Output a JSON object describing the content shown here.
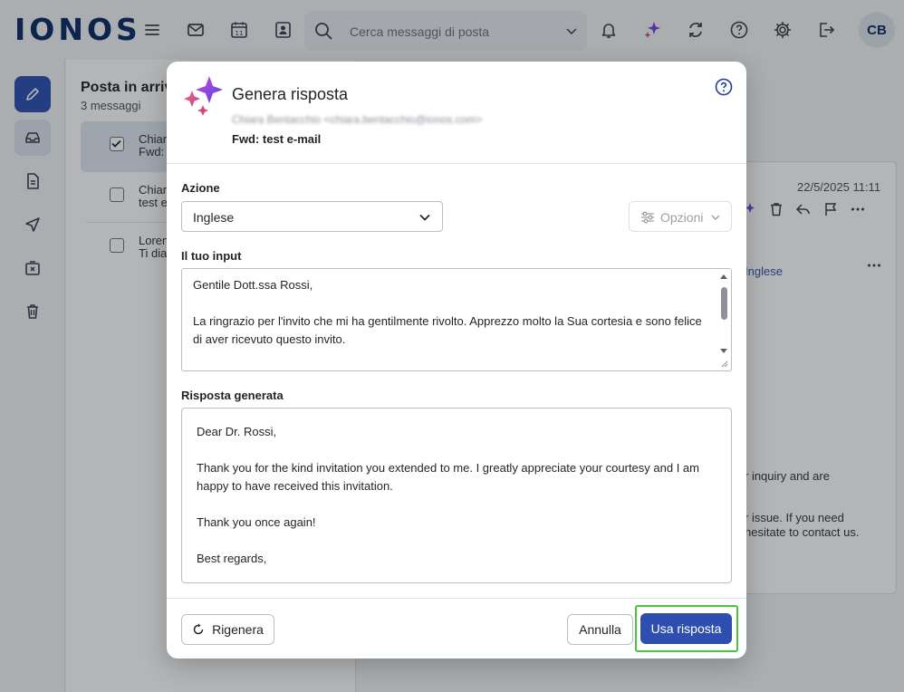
{
  "app": {
    "logo": "IONOS",
    "search_placeholder": "Cerca messaggi di posta",
    "avatar_initials": "CB"
  },
  "mail_list": {
    "title": "Posta in arrivo",
    "count": "3 messaggi",
    "rows": [
      {
        "line1": "Chiar",
        "line2": "Fwd: t"
      },
      {
        "line1": "Chiar",
        "line2": "test e"
      },
      {
        "line1": "Loren",
        "line2": "Ti dia"
      }
    ]
  },
  "reader": {
    "date": "22/5/2025 11:11",
    "language_link": "Inglese",
    "body_1": "r inquiry and are",
    "body_2": "r issue. If you need",
    "body_3": "hesitate to contact us."
  },
  "dialog": {
    "title": "Genera risposta",
    "sender": "Chiara Bentacchio <chiara.bentacchio@ionos.com>",
    "subject": "Fwd: test e-mail",
    "action_label": "Azione",
    "action_value": "Inglese",
    "options_label": "Opzioni",
    "input_label": "Il tuo input",
    "input_text": "Gentile Dott.ssa Rossi,\n\nLa ringrazio per l'invito che mi ha gentilmente rivolto. Apprezzo molto la Sua cortesia e sono felice di aver ricevuto questo invito.\n\nLa ringrazio ancora!",
    "generated_label": "Risposta generata",
    "generated_text": "Dear Dr. Rossi,\n\nThank you for the kind invitation you extended to me. I greatly appreciate your courtesy and I am happy to have received this invitation.\n\nThank you once again!\n\nBest regards,",
    "regenerate_label": "Rigenera",
    "cancel_label": "Annulla",
    "use_label": "Usa risposta"
  },
  "colors": {
    "primary": "#2f4fb0",
    "highlight": "#4cc43a",
    "logo": "#0b2a63"
  }
}
